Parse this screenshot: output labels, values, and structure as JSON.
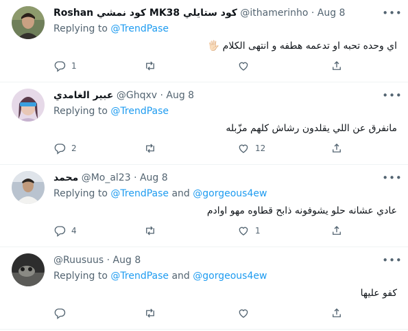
{
  "tweets": [
    {
      "name": "Roshan كود نمشي MK38 كود ستايلي",
      "handle": "@ithamerinho",
      "date": "Aug 8",
      "replying_prefix": "Replying to",
      "replying_to": [
        "@TrendPase"
      ],
      "text": "اي وحده تحبه او تدعمه هطفه و انتهى الكلام 🖐🏻",
      "reply_count": "1",
      "retweet_count": "",
      "like_count": ""
    },
    {
      "name": "عبير الغامدي",
      "handle": "@Ghqxv",
      "date": "Aug 8",
      "replying_prefix": "Replying to",
      "replying_to": [
        "@TrendPase"
      ],
      "text": "مانفرق عن اللي يقلدون رشاش كلهم مزّبله",
      "reply_count": "2",
      "retweet_count": "",
      "like_count": "12"
    },
    {
      "name": "محمد",
      "handle": "@Mo_al23",
      "date": "Aug 8",
      "replying_prefix": "Replying to",
      "replying_to": [
        "@TrendPase",
        "@gorgeous4ew"
      ],
      "joiner": "and",
      "text": "عادي عشانه حلو يشوفونه ذابح قطاوه مهو اوادم",
      "reply_count": "4",
      "retweet_count": "",
      "like_count": "1"
    },
    {
      "name": "",
      "handle": "@Ruusuus",
      "date": "Aug 8",
      "replying_prefix": "Replying to",
      "replying_to": [
        "@TrendPase",
        "@gorgeous4ew"
      ],
      "joiner": "and",
      "text": "كفو عليها",
      "reply_count": "",
      "retweet_count": "",
      "like_count": ""
    }
  ],
  "separator": "·",
  "more_glyph": "•••",
  "colors": {
    "link": "#1d9bf0",
    "secondary_text": "#536471",
    "primary_text": "#0f1419",
    "divider": "#eff3f4"
  },
  "icons": [
    "reply-icon",
    "retweet-icon",
    "like-icon",
    "share-icon",
    "more-icon"
  ]
}
